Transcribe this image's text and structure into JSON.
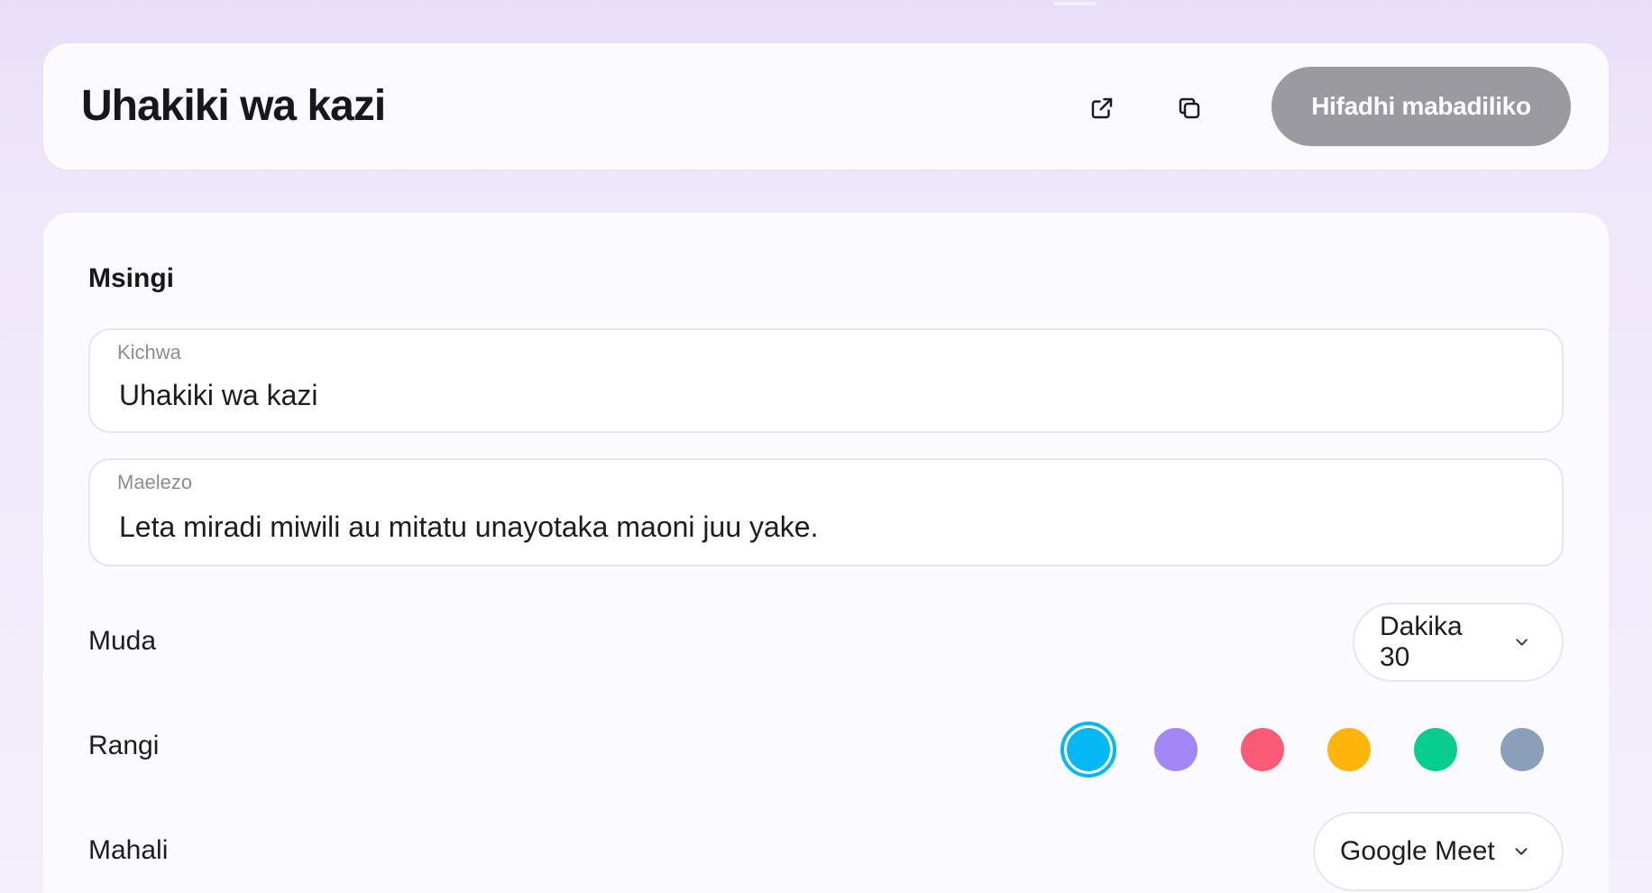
{
  "header": {
    "title": "Uhakiki wa kazi",
    "save_label": "Hifadhi mabadiliko"
  },
  "basics": {
    "section_title": "Msingi",
    "title_field": {
      "label": "Kichwa",
      "value": "Uhakiki wa kazi"
    },
    "description_field": {
      "label": "Maelezo",
      "value": "Leta miradi miwili au mitatu unayotaka maoni juu yake."
    },
    "duration": {
      "label": "Muda",
      "selected": "Dakika 30"
    },
    "color": {
      "label": "Rangi",
      "options": [
        "#04b8f4",
        "#a487f6",
        "#fb5b77",
        "#fdb50b",
        "#07ce8e",
        "#8c9fb8"
      ],
      "selected_index": 0
    },
    "location": {
      "label": "Mahali",
      "selected": "Google Meet"
    }
  },
  "icons": {
    "open": "external-link-icon",
    "copy": "copy-icon",
    "chevron": "chevron-down-icon"
  }
}
